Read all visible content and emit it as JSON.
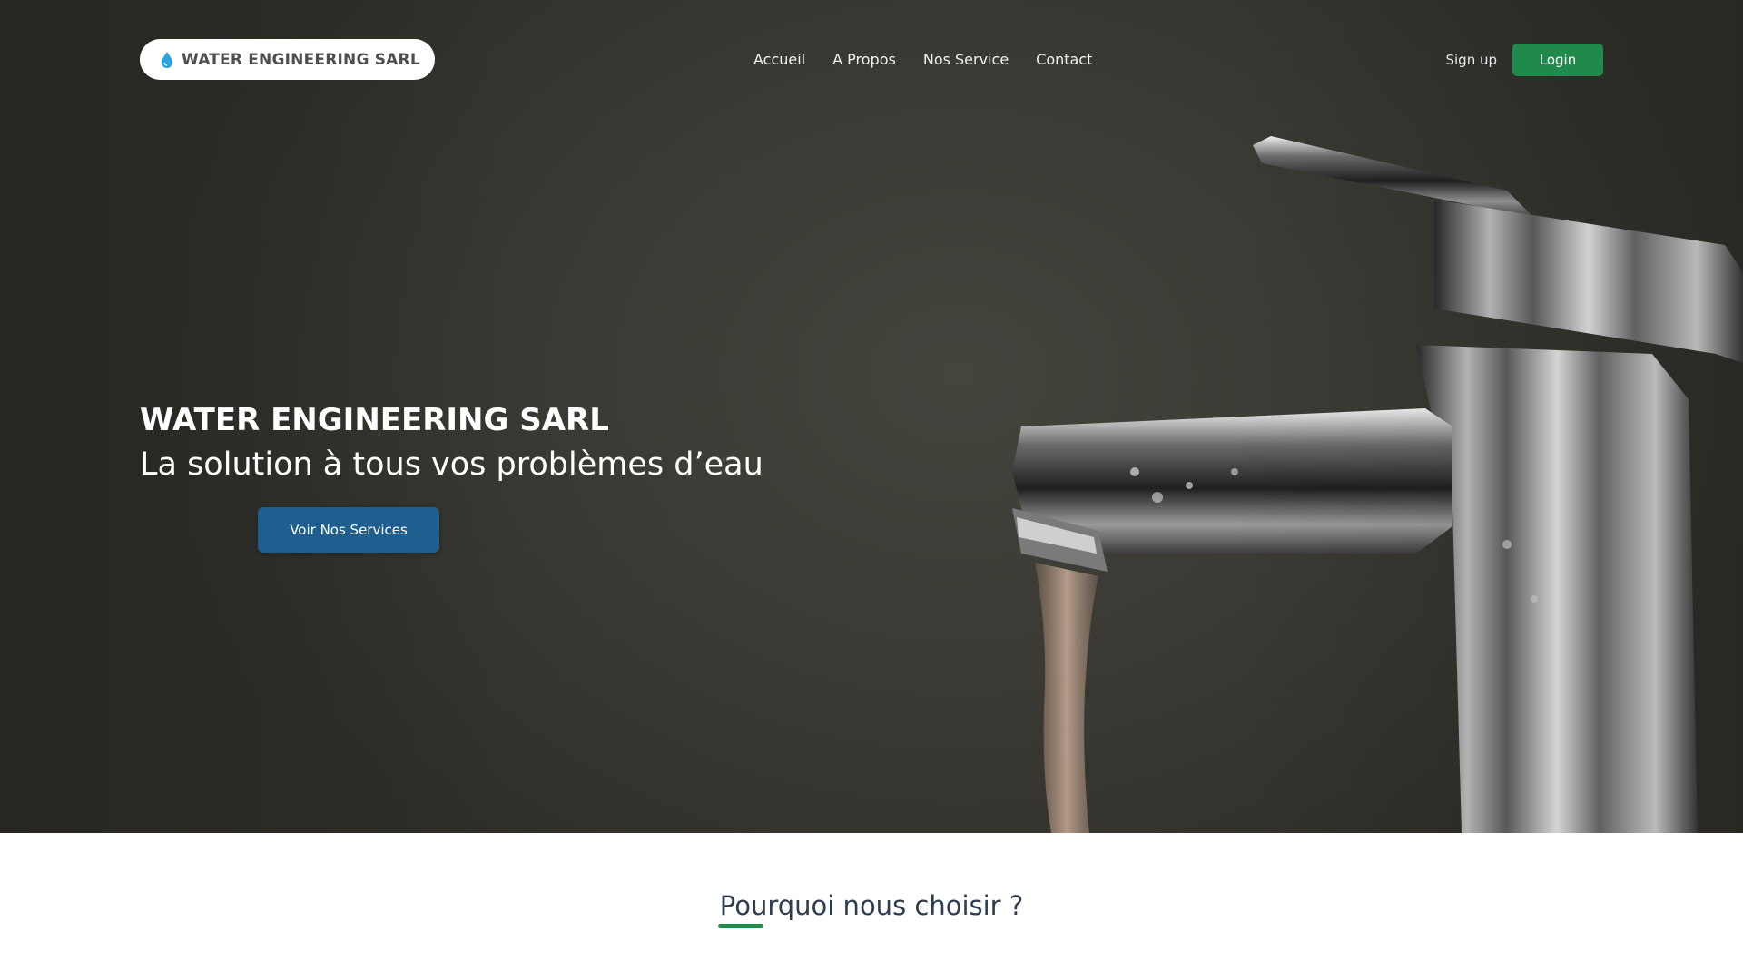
{
  "navbar": {
    "brand_name": "WATER ENGINEERING SARL",
    "brand_icon": "water-drop-icon",
    "links": [
      "Accueil",
      "A Propos",
      "Nos Service",
      "Contact"
    ],
    "signup_label": "Sign up",
    "login_label": "Login"
  },
  "hero": {
    "title": "WATER ENGINEERING SARL",
    "subtitle": "La solution à tous vos problèmes d’eau",
    "cta_label": "Voir Nos Services",
    "background_image": "chrome-faucet-running-water"
  },
  "why_section": {
    "title": "Pourquoi nous choisir ?"
  },
  "colors": {
    "accent_green": "#1f8a4c",
    "cta_blue": "#1f5f8f",
    "hero_bg": "#3b3a34",
    "heading_dark": "#2f3e4e"
  }
}
